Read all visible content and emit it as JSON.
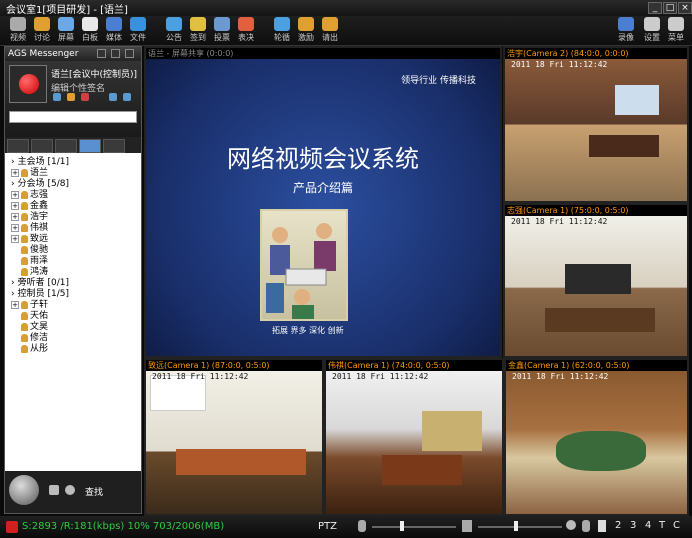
{
  "window": {
    "title": "会议室1[项目研发] - [语兰]"
  },
  "toolbar": {
    "items": [
      {
        "label": "视频",
        "icon": "video-icon",
        "color": "#aaaaaa"
      },
      {
        "label": "讨论",
        "icon": "discuss-icon",
        "color": "#e0a030"
      },
      {
        "label": "屏幕",
        "icon": "screen-icon",
        "color": "#6aa8e8"
      },
      {
        "label": "白板",
        "icon": "whiteboard-icon",
        "color": "#e8e8e8"
      },
      {
        "label": "媒体",
        "icon": "media-icon",
        "color": "#4a7fd0"
      },
      {
        "label": "文件",
        "icon": "file-icon",
        "color": "#3a90e0"
      },
      {
        "label": "公告",
        "icon": "notice-icon",
        "color": "#4aa0e0"
      },
      {
        "label": "签到",
        "icon": "signin-icon",
        "color": "#e0c040"
      },
      {
        "label": "投票",
        "icon": "vote-icon",
        "color": "#6a9ad0"
      },
      {
        "label": "表决",
        "icon": "decision-icon",
        "color": "#e06040"
      },
      {
        "label": "轮循",
        "icon": "rotate-icon",
        "color": "#4aa0e0"
      },
      {
        "label": "激励",
        "icon": "encourage-icon",
        "color": "#e0a030"
      },
      {
        "label": "请出",
        "icon": "kick-icon",
        "color": "#e0a030"
      },
      {
        "label": "录像",
        "icon": "record-icon",
        "color": "#4a7fd0"
      },
      {
        "label": "设置",
        "icon": "settings-icon",
        "color": "#cccccc"
      },
      {
        "label": "菜单",
        "icon": "menu-icon",
        "color": "#cccccc"
      }
    ]
  },
  "messenger": {
    "title": "AGS Messenger",
    "user": "语兰[会议中(控制员)]",
    "signature": "编辑个性签名",
    "find_label": "查找",
    "tree": [
      {
        "label": "主会场 [1/1]",
        "type": "group",
        "exp": ">"
      },
      {
        "label": "语兰",
        "type": "person",
        "exp": "+"
      },
      {
        "label": "分会场 [5/8]",
        "type": "group",
        "exp": ">"
      },
      {
        "label": "志强",
        "type": "person",
        "exp": "+"
      },
      {
        "label": "金鑫",
        "type": "person",
        "exp": "+"
      },
      {
        "label": "浩宇",
        "type": "person",
        "exp": "+"
      },
      {
        "label": "伟祺",
        "type": "person",
        "exp": "+"
      },
      {
        "label": "致远",
        "type": "person",
        "exp": "+"
      },
      {
        "label": "俊驰",
        "type": "person",
        "exp": ""
      },
      {
        "label": "雨泽",
        "type": "person",
        "exp": ""
      },
      {
        "label": "鸿涛",
        "type": "person",
        "exp": ""
      },
      {
        "label": "旁听者 [0/1]",
        "type": "group",
        "exp": ">"
      },
      {
        "label": "控制员 [1/5]",
        "type": "group",
        "exp": ">"
      },
      {
        "label": "子轩",
        "type": "person",
        "exp": "+"
      },
      {
        "label": "天佑",
        "type": "person",
        "exp": ""
      },
      {
        "label": "文昊",
        "type": "person",
        "exp": ""
      },
      {
        "label": "修洁",
        "type": "person",
        "exp": ""
      },
      {
        "label": "从彤",
        "type": "person",
        "exp": ""
      }
    ]
  },
  "panes": {
    "main": {
      "header": "语兰 - 屏幕共享 (0:0:0)",
      "slide_corp": "领导行业  传播科技",
      "slide_title": "网络视频会议系统",
      "slide_sub": "产品介绍篇",
      "slide_caption": "拓展  界多  深化  创新"
    },
    "p1": {
      "header": "浩宇(Camera 2)  (84:0:0, 0:0:0)",
      "time": "2011  18  Fri 11:12:42"
    },
    "p2": {
      "header": "志强(Camera 1)  (75:0:0, 0:5:0)",
      "time": "2011  18  Fri 11:12:42"
    },
    "p3": {
      "header": "致远(Camera 1)  (87:0:0, 0:5:0)",
      "time": "2011  18  Fri 11:12:42"
    },
    "p4": {
      "header": "伟祺(Camera 1)  (74:0:0, 0:5:0)",
      "time": "2011  18  Fri 11:12:42"
    },
    "p5": {
      "header": "金鑫(Camera 1)  (62:0:0, 0:5:0)",
      "time": "2011  18  Fri 11:12:42"
    }
  },
  "status": {
    "rate": "S:2893 /R:181(kbps) 10% 703/2006(MB)",
    "ptz": "PTZ",
    "nums": [
      "2",
      "3",
      "4",
      "T",
      "C"
    ]
  }
}
